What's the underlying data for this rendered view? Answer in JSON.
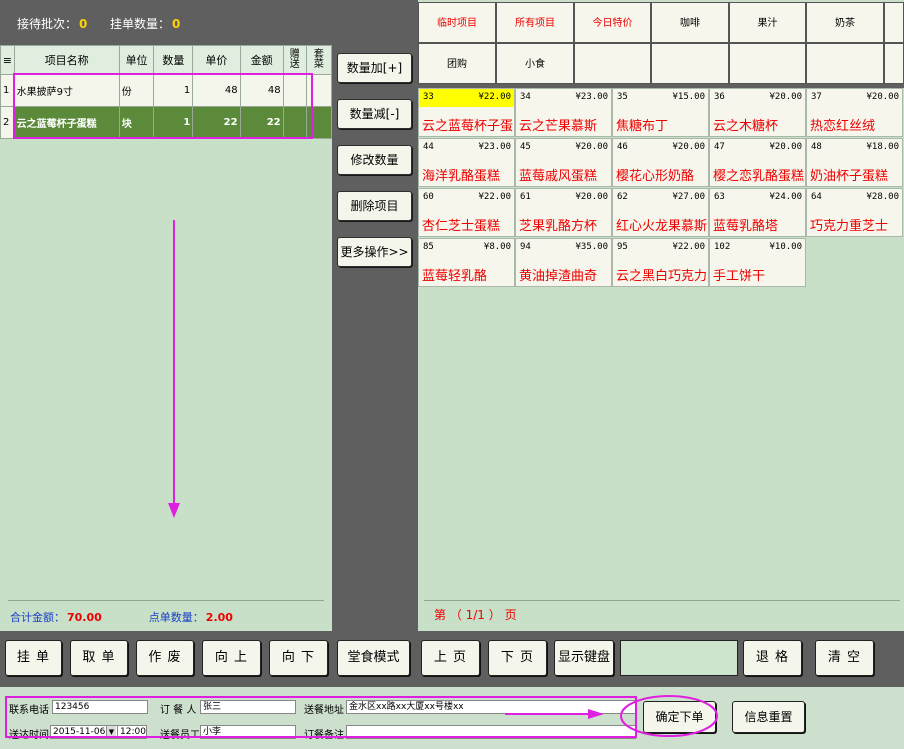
{
  "topbar": {
    "pending_label": "接待批次：",
    "pending_value": "0",
    "hold_label": "挂单数量：",
    "hold_value": "0"
  },
  "grid": {
    "columns": [
      "≡",
      "项目名称",
      "单位",
      "数量",
      "单价",
      "金额",
      "赠送",
      "套菜"
    ],
    "rows": [
      {
        "idx": "1",
        "name": "水果披萨9寸",
        "unit": "份",
        "qty": "1",
        "price": "48",
        "amount": "48"
      },
      {
        "idx": "2",
        "name": "云之蓝莓杯子蛋糕",
        "unit": "块",
        "qty": "1",
        "price": "22",
        "amount": "22"
      }
    ]
  },
  "totals": {
    "amount_label": "合计金额：",
    "amount_value": "70.00",
    "count_label": "点单数量：",
    "count_value": "2.00"
  },
  "side_buttons": {
    "qty_plus": "数量加[+]",
    "qty_minus": "数量减[-]",
    "edit_qty": "修改数量",
    "delete_item": "删除项目",
    "more_ops": "更多操作>>"
  },
  "tabs": {
    "row1": [
      "临时项目",
      "所有项目",
      "今日特价",
      "咖啡",
      "果汁",
      "奶茶",
      ""
    ],
    "row2": [
      "团购",
      "小食",
      "",
      "",
      "",
      "",
      ""
    ]
  },
  "menu_items": [
    {
      "code": "33",
      "price": "¥22.00",
      "name": "云之蓝莓杯子蛋"
    },
    {
      "code": "34",
      "price": "¥23.00",
      "name": "云之芒果慕斯"
    },
    {
      "code": "35",
      "price": "¥15.00",
      "name": "焦糖布丁"
    },
    {
      "code": "36",
      "price": "¥20.00",
      "name": "云之木糖杯"
    },
    {
      "code": "37",
      "price": "¥20.00",
      "name": "热恋红丝绒"
    },
    {
      "code": "44",
      "price": "¥23.00",
      "name": "海洋乳酪蛋糕"
    },
    {
      "code": "45",
      "price": "¥20.00",
      "name": "蓝莓戚风蛋糕"
    },
    {
      "code": "46",
      "price": "¥20.00",
      "name": "樱花心形奶酪"
    },
    {
      "code": "47",
      "price": "¥20.00",
      "name": "樱之恋乳酪蛋糕"
    },
    {
      "code": "48",
      "price": "¥18.00",
      "name": "奶油杯子蛋糕"
    },
    {
      "code": "60",
      "price": "¥22.00",
      "name": "杏仁芝士蛋糕"
    },
    {
      "code": "61",
      "price": "¥20.00",
      "name": "芝果乳酪方杯"
    },
    {
      "code": "62",
      "price": "¥27.00",
      "name": "红心火龙果慕斯"
    },
    {
      "code": "63",
      "price": "¥24.00",
      "name": "蓝莓乳酪塔"
    },
    {
      "code": "64",
      "price": "¥28.00",
      "name": "巧克力重芝士"
    },
    {
      "code": "85",
      "price": "¥8.00",
      "name": "蓝莓轻乳酪"
    },
    {
      "code": "94",
      "price": "¥35.00",
      "name": "黄油掉渣曲奇"
    },
    {
      "code": "95",
      "price": "¥22.00",
      "name": "云之黑白巧克力"
    },
    {
      "code": "102",
      "price": "¥10.00",
      "name": "手工饼干"
    }
  ],
  "pagination": {
    "text": "第 （ 1/1 ） 页"
  },
  "bottom_buttons": {
    "hang": "挂 单",
    "take": "取 单",
    "void": "作 废",
    "up": "向 上",
    "down": "向 下",
    "dine_mode": "堂食模式",
    "prev_page": "上 页",
    "next_page": "下 页",
    "show_keyboard": "显示键盘",
    "backspace": "退 格",
    "clear": "清 空"
  },
  "form": {
    "phone_label": "联系电话",
    "phone_value": "123456",
    "orderer_label": "订 餐 人",
    "orderer_value": "张三",
    "address_label": "送餐地址",
    "address_value": "金水区xx路xx大厦xx号楼xx",
    "time_label": "送达时间",
    "date_value": "2015-11-06",
    "time_value": "12:00",
    "staff_label": "送餐员工",
    "staff_value": "小李",
    "note_label": "订餐备注",
    "note_value": "",
    "confirm": "确定下单",
    "reset": "信息重置"
  },
  "colors": {
    "panel_bg": "#c8e0c8",
    "dark_bar": "#5f5f5f",
    "selected_row": "#5a8a3a",
    "highlight_item": "#ffff00",
    "item_name": "#e00000",
    "annotation": "#e020e0"
  }
}
